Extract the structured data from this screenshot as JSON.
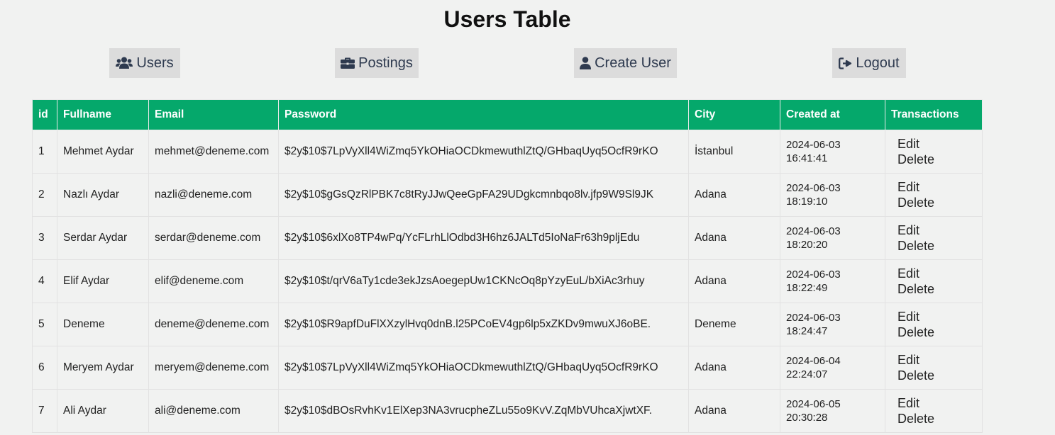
{
  "title": "Users Table",
  "nav": {
    "users": {
      "label": "Users",
      "icon": "users-icon"
    },
    "postings": {
      "label": "Postings",
      "icon": "briefcase-icon"
    },
    "create_user": {
      "label": "Create User",
      "icon": "user-icon"
    },
    "logout": {
      "label": "Logout",
      "icon": "logout-icon"
    }
  },
  "colors": {
    "header_bg": "#05a86b",
    "nav_bg": "#dcdcdc",
    "nav_text": "#2e3a4f"
  },
  "table": {
    "headers": [
      "id",
      "Fullname",
      "Email",
      "Password",
      "City",
      "Created at",
      "Transactions"
    ],
    "rows": [
      {
        "id": "1",
        "fullname": "Mehmet Aydar",
        "email": "mehmet@deneme.com",
        "password": "$2y$10$7LpVyXll4WiZmq5YkOHiaOCDkmewuthlZtQ/GHbaqUyq5OcfR9rKO",
        "city": "İstanbul",
        "created_date": "2024-06-03",
        "created_time": "16:41:41",
        "edit": "Edit",
        "delete": "Delete"
      },
      {
        "id": "2",
        "fullname": "Nazlı Aydar",
        "email": "nazli@deneme.com",
        "password": "$2y$10$gGsQzRlPBK7c8tRyJJwQeeGpFA29UDgkcmnbqo8lv.jfp9W9Sl9JK",
        "city": "Adana",
        "created_date": "2024-06-03",
        "created_time": "18:19:10",
        "edit": "Edit",
        "delete": "Delete"
      },
      {
        "id": "3",
        "fullname": "Serdar Aydar",
        "email": "serdar@deneme.com",
        "password": "$2y$10$6xlXo8TP4wPq/YcFLrhLlOdbd3H6hz6JALTd5IoNaFr63h9pljEdu",
        "city": "Adana",
        "created_date": "2024-06-03",
        "created_time": "18:20:20",
        "edit": "Edit",
        "delete": "Delete"
      },
      {
        "id": "4",
        "fullname": "Elif Aydar",
        "email": "elif@deneme.com",
        "password": "$2y$10$t/qrV6aTy1cde3ekJzsAoegepUw1CKNcOq8pYzyEuL/bXiAc3rhuy",
        "city": "Adana",
        "created_date": "2024-06-03",
        "created_time": "18:22:49",
        "edit": "Edit",
        "delete": "Delete"
      },
      {
        "id": "5",
        "fullname": "Deneme",
        "email": "deneme@deneme.com",
        "password": "$2y$10$R9apfDuFlXXzylHvq0dnB.l25PCoEV4gp6lp5xZKDv9mwuXJ6oBE.",
        "city": "Deneme",
        "created_date": "2024-06-03",
        "created_time": "18:24:47",
        "edit": "Edit",
        "delete": "Delete"
      },
      {
        "id": "6",
        "fullname": "Meryem Aydar",
        "email": "meryem@deneme.com",
        "password": "$2y$10$7LpVyXll4WiZmq5YkOHiaOCDkmewuthlZtQ/GHbaqUyq5OcfR9rKO",
        "city": "Adana",
        "created_date": "2024-06-04",
        "created_time": "22:24:07",
        "edit": "Edit",
        "delete": "Delete"
      },
      {
        "id": "7",
        "fullname": "Ali Aydar",
        "email": "ali@deneme.com",
        "password": "$2y$10$dBOsRvhKv1ElXep3NA3vrucpheZLu55o9KvV.ZqMbVUhcaXjwtXF.",
        "city": "Adana",
        "created_date": "2024-06-05",
        "created_time": "20:30:28",
        "edit": "Edit",
        "delete": "Delete"
      }
    ]
  }
}
